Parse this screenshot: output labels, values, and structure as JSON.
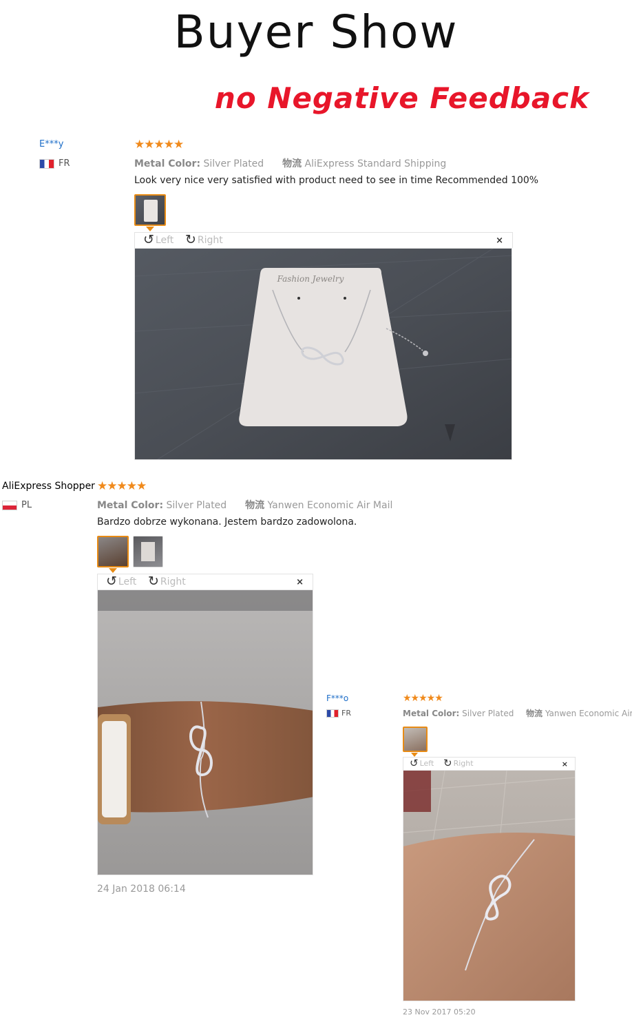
{
  "header": {
    "title": "Buyer Show",
    "subtitle": "no Negative Feedback"
  },
  "reviews": [
    {
      "user": "E***y",
      "country": "FR",
      "stars": "★★★★★",
      "meta_label": "Metal Color:",
      "meta_value": "Silver Plated",
      "shipping_label": "物流",
      "shipping_value": "AliExpress Standard Shipping",
      "text": "Look very nice very satisfied with product need to see in time Recommended 100%",
      "rotate_left": "Left",
      "rotate_right": "Right",
      "close": "×"
    },
    {
      "user": "AliExpress Shopper",
      "country": "PL",
      "stars": "★★★★★",
      "meta_label": "Metal Color:",
      "meta_value": "Silver Plated",
      "shipping_label": "物流",
      "shipping_value": "Yanwen Economic Air Mail",
      "text": "Bardzo dobrze wykonana. Jestem bardzo zadowolona.",
      "rotate_left": "Left",
      "rotate_right": "Right",
      "close": "×",
      "date": "24 Jan 2018 06:14"
    },
    {
      "user": "F***o",
      "country": "FR",
      "stars": "★★★★★",
      "meta_label": "Metal Color:",
      "meta_value": "Silver Plated",
      "shipping_label": "物流",
      "shipping_value": "Yanwen Economic Air Mail",
      "rotate_left": "Left",
      "rotate_right": "Right",
      "close": "×",
      "date": "23 Nov 2017 05:20"
    }
  ],
  "icons": {
    "rotate_left": "↺",
    "rotate_right": "↻"
  },
  "colors": {
    "star": "#f08a1c",
    "accent_red": "#e8162a",
    "thumb_border": "#e88b14",
    "username_link": "#1e6ec8"
  }
}
